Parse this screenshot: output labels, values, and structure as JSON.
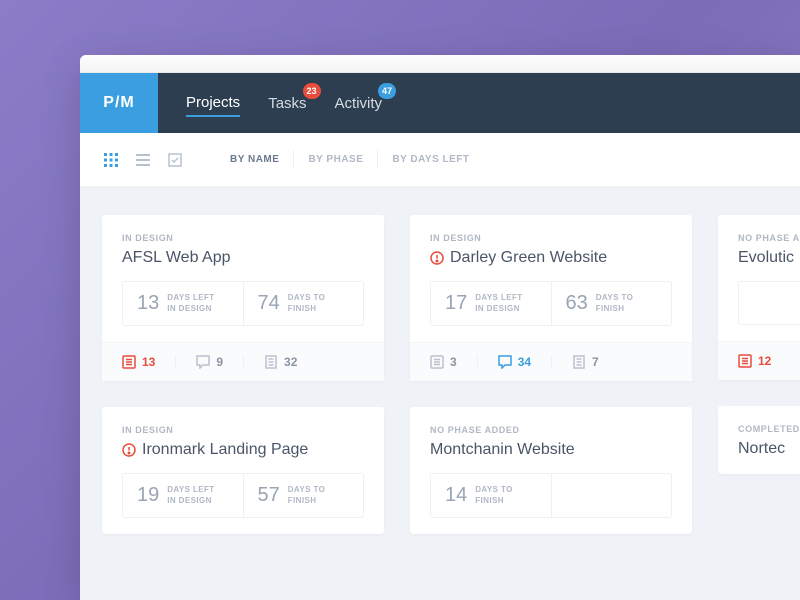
{
  "logo": "P/M",
  "nav": [
    {
      "label": "Projects",
      "active": true
    },
    {
      "label": "Tasks",
      "badge": "23",
      "badgeColor": "red"
    },
    {
      "label": "Activity",
      "badge": "47",
      "badgeColor": "blue"
    }
  ],
  "sort": [
    {
      "label": "BY NAME",
      "active": true
    },
    {
      "label": "BY PHASE"
    },
    {
      "label": "BY DAYS LEFT"
    }
  ],
  "cards": [
    {
      "phase": "IN DESIGN",
      "title": "AFSL Web App",
      "alert": false,
      "stat1_num": "13",
      "stat1_l1": "DAYS LEFT",
      "stat1_l2": "IN DESIGN",
      "stat2_num": "74",
      "stat2_l1": "DAYS TO",
      "stat2_l2": "FINISH",
      "meta1": "13",
      "meta1_hl": "red",
      "meta2": "9",
      "meta3": "32"
    },
    {
      "phase": "IN DESIGN",
      "title": "Darley Green Website",
      "alert": true,
      "stat1_num": "17",
      "stat1_l1": "DAYS LEFT",
      "stat1_l2": "IN DESIGN",
      "stat2_num": "63",
      "stat2_l1": "DAYS TO",
      "stat2_l2": "FINISH",
      "meta1": "3",
      "meta2": "34",
      "meta2_hl": "blue",
      "meta3": "7"
    },
    {
      "phase": "NO PHASE A",
      "title": "Evolutic",
      "meta1": "12",
      "meta1_hl": "red"
    },
    {
      "phase": "IN DESIGN",
      "title": "Ironmark Landing Page",
      "alert": true,
      "stat1_num": "19",
      "stat1_l1": "DAYS LEFT",
      "stat1_l2": "IN DESIGN",
      "stat2_num": "57",
      "stat2_l1": "DAYS TO",
      "stat2_l2": "FINISH"
    },
    {
      "phase": "NO PHASE ADDED",
      "title": "Montchanin Website",
      "stat1_num": "14",
      "stat1_l1": "DAYS TO",
      "stat1_l2": "FINISH"
    },
    {
      "phase": "COMPLETED",
      "title": "Nortec"
    }
  ]
}
